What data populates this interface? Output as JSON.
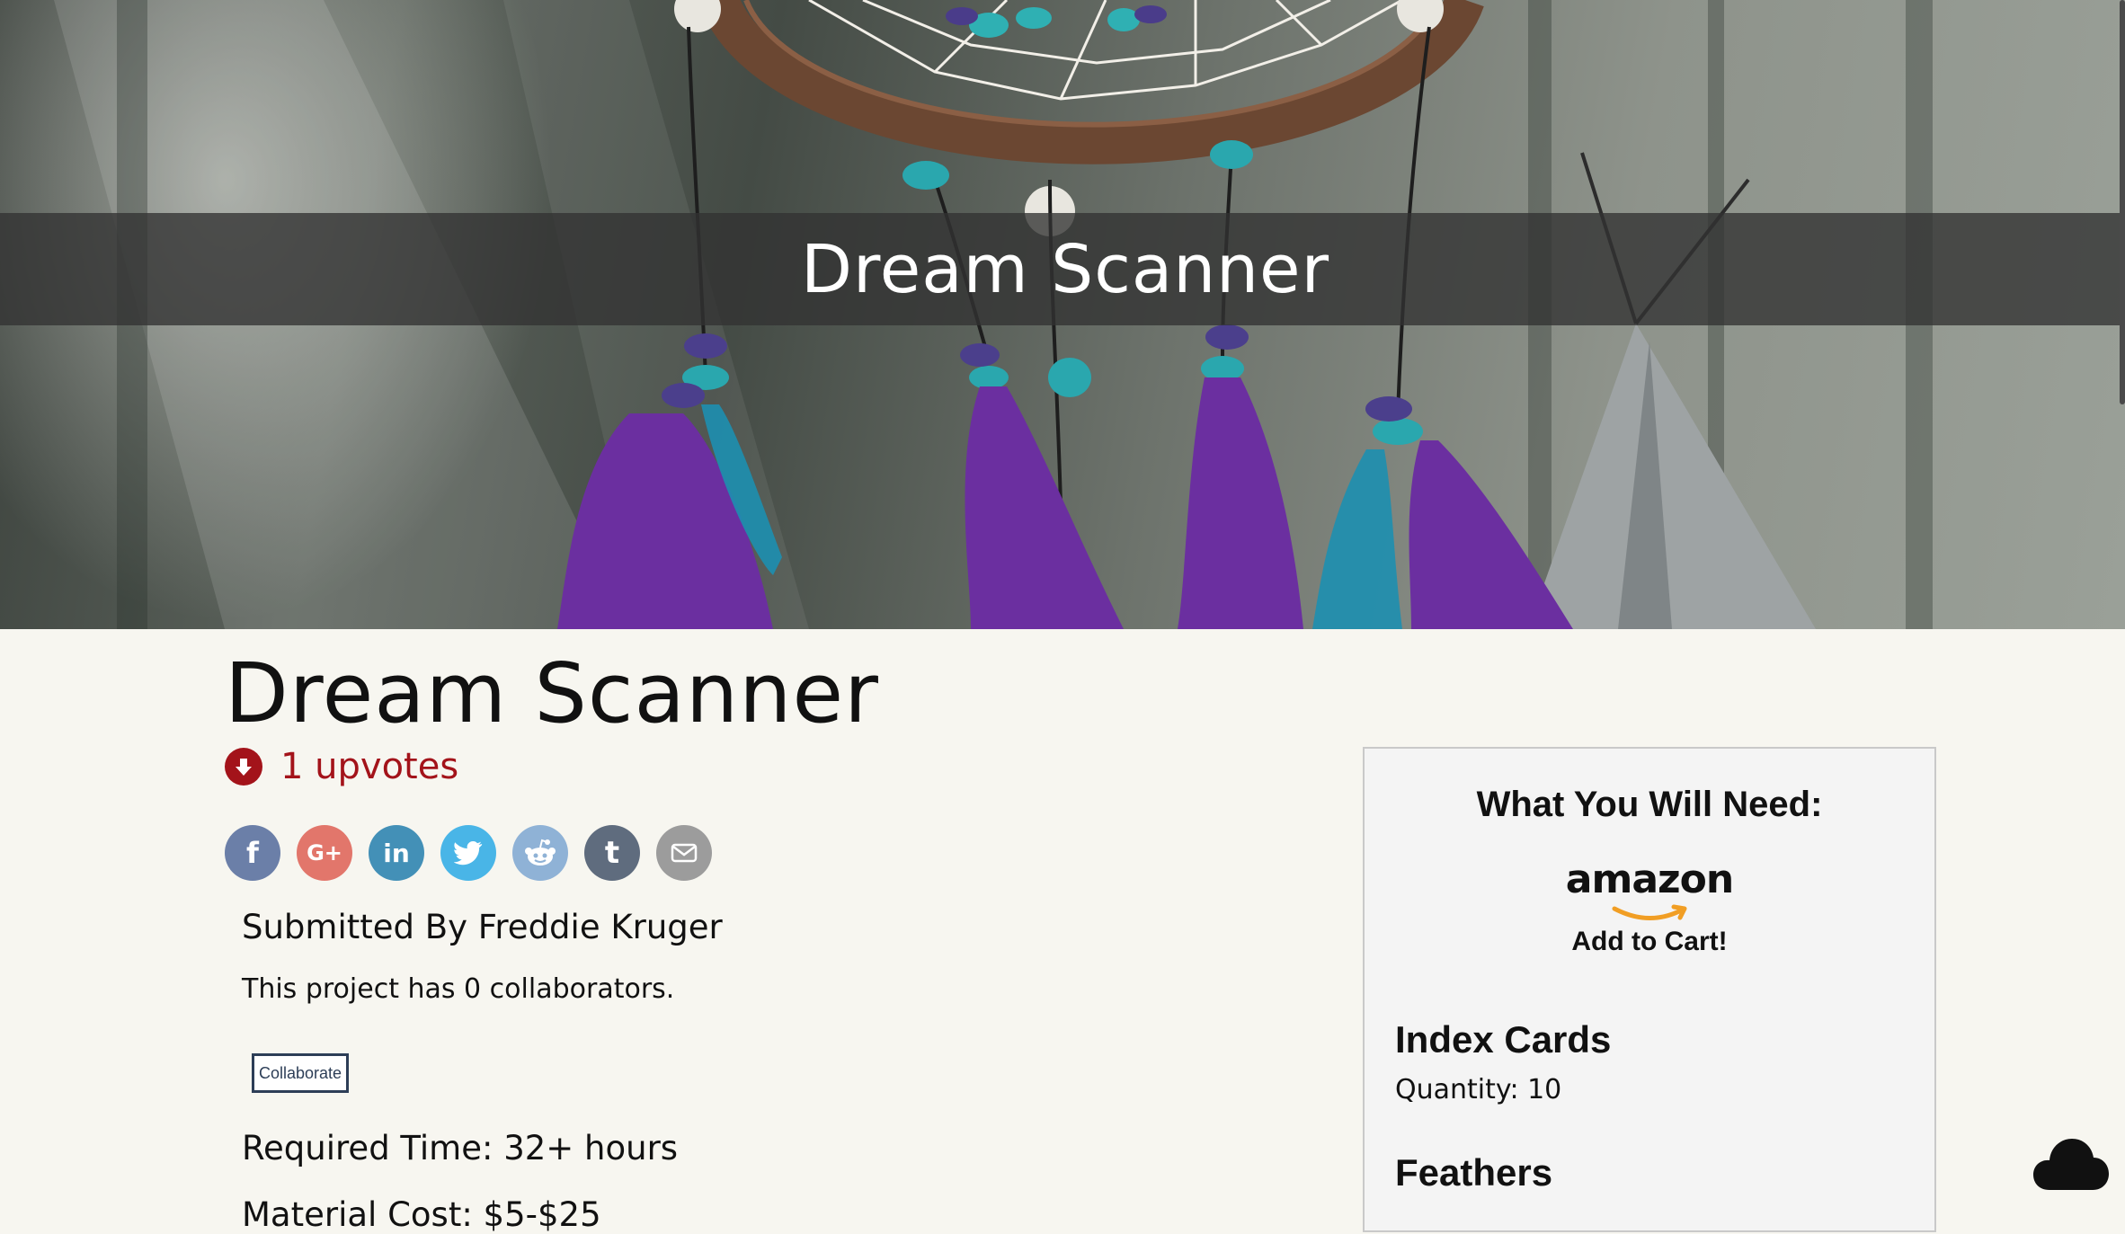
{
  "hero": {
    "title": "Dream Scanner"
  },
  "project": {
    "title": "Dream Scanner",
    "upvotes_label": "1 upvotes",
    "submitted_by": "Submitted By Freddie Kruger",
    "collaborators_text": "This project has 0 collaborators.",
    "collaborate_label": "Collaborate",
    "required_time": "Required Time: 32+ hours",
    "material_cost": "Material Cost: $5-$25"
  },
  "share": [
    {
      "network": "facebook",
      "glyph": "f",
      "icon": "facebook-icon",
      "color": "#6b7fa8"
    },
    {
      "network": "google-plus",
      "glyph": "G+",
      "icon": "google-plus-icon",
      "color": "#e2766b"
    },
    {
      "network": "linkedin",
      "glyph": "in",
      "icon": "linkedin-icon",
      "color": "#4390b7"
    },
    {
      "network": "twitter",
      "glyph": "",
      "icon": "twitter-icon",
      "color": "#49b5e7"
    },
    {
      "network": "reddit",
      "glyph": "",
      "icon": "reddit-icon",
      "color": "#8fb2d6"
    },
    {
      "network": "tumblr",
      "glyph": "t",
      "icon": "tumblr-icon",
      "color": "#5f6c7e"
    },
    {
      "network": "email",
      "glyph": "",
      "icon": "email-icon",
      "color": "#9c9c9c"
    }
  ],
  "needs": {
    "title": "What You Will Need:",
    "vendor": "amazon",
    "add_to_cart": "Add to Cart!",
    "items": [
      {
        "name": "Index Cards",
        "quantity": "Quantity: 10"
      },
      {
        "name": "Feathers",
        "quantity": ""
      }
    ]
  },
  "colors": {
    "upvote": "#a3131a",
    "background": "#f7f6f0",
    "collab_border": "#2d3e57"
  }
}
